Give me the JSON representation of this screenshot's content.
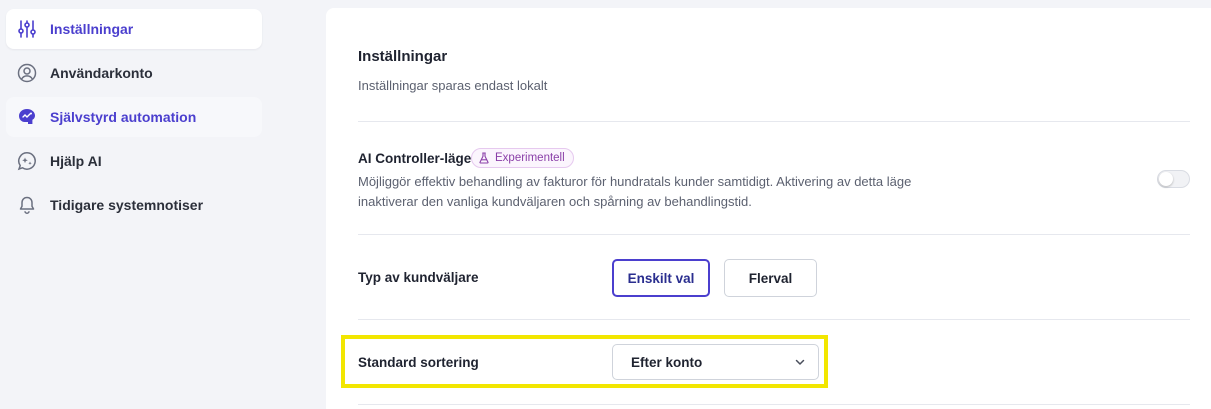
{
  "sidebar": {
    "items": [
      {
        "label": "Inställningar",
        "icon": "sliders-icon",
        "state": "active"
      },
      {
        "label": "Användarkonto",
        "icon": "user-circle-icon",
        "state": "normal"
      },
      {
        "label": "Självstyrd automation",
        "icon": "brain-icon",
        "state": "highlighted"
      },
      {
        "label": "Hjälp AI",
        "icon": "sparkle-chat-icon",
        "state": "normal"
      },
      {
        "label": "Tidigare systemnotiser",
        "icon": "bell-icon",
        "state": "normal"
      }
    ]
  },
  "settings": {
    "title": "Inställningar",
    "subtitle": "Inställningar sparas endast lokalt",
    "ai_controller": {
      "label": "AI Controller-läge",
      "badge": "Experimentell",
      "description": "Möjliggör effektiv behandling av fakturor för hundratals kunder samtidigt. Aktivering av detta läge inaktiverar den vanliga kundväljaren och spårning av behandlingstid.",
      "enabled": false
    },
    "customer_selector": {
      "label": "Typ av kundväljare",
      "options": [
        "Enskilt val",
        "Flerval"
      ],
      "selected": "Enskilt val"
    },
    "default_sorting": {
      "label": "Standard sortering",
      "value": "Efter konto"
    }
  },
  "colors": {
    "accent": "#4b3fce",
    "badge": "#8a3fa8",
    "highlight": "#f2e600",
    "background": "#f3f4f8"
  }
}
